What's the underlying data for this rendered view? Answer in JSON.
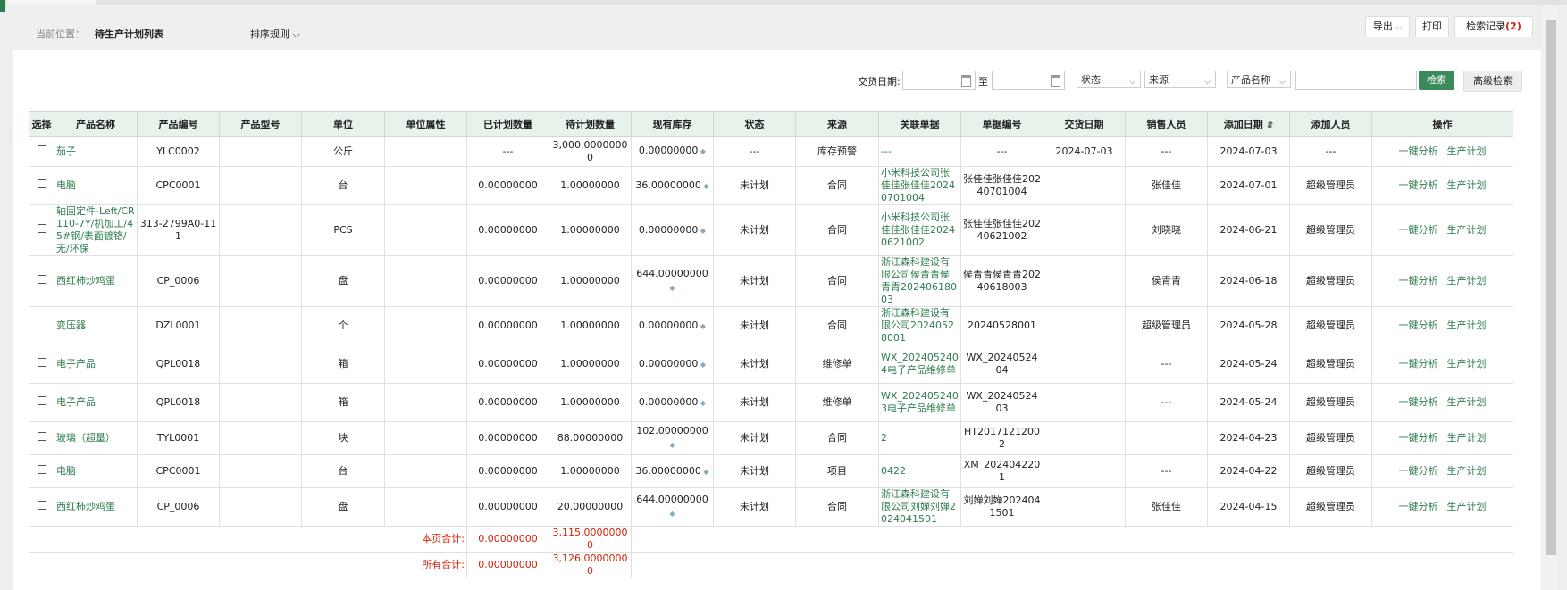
{
  "breadcrumb": {
    "label": "当前位置：",
    "value": "待生产计划列表"
  },
  "sort_label": "排序规则",
  "toolbar": {
    "export": "导出",
    "print": "打印",
    "search_record": "检索记录",
    "search_record_count": "(2)"
  },
  "filters": {
    "delivery_date_label": "交货日期:",
    "to_label": "至",
    "status": "状态",
    "source": "来源",
    "product_name": "产品名称",
    "search": "检索",
    "advanced_search": "高级检索"
  },
  "columns": [
    "选择",
    "产品名称",
    "产品编号",
    "产品型号",
    "单位",
    "单位属性",
    "已计划数量",
    "待计划数量",
    "现有库存",
    "状态",
    "来源",
    "关联单据",
    "单据编号",
    "交货日期",
    "销售人员",
    "添加日期",
    "添加人员",
    "操作"
  ],
  "actions": {
    "analyze": "一键分析",
    "plan": "生产计划"
  },
  "rows": [
    {
      "name": "茄子",
      "code": "YLC0002",
      "model": "",
      "unit": "公斤",
      "unit_attr": "",
      "planned": "---",
      "pending": "3,000.0000000 0",
      "stock": "0.00000000",
      "status": "---",
      "source": "库存预警",
      "related": "---",
      "doc_no": "---",
      "delivery": "2024-07-03",
      "sales": "---",
      "added": "2024-07-03",
      "adder": "---"
    },
    {
      "name": "电脑",
      "code": "CPC0001",
      "model": "",
      "unit": "台",
      "unit_attr": "",
      "planned": "0.00000000",
      "pending": "1.00000000",
      "stock": "36.00000000",
      "status": "未计划",
      "source": "合同",
      "related": "小米科技公司张佳佳张佳佳20240701004",
      "doc_no": "张佳佳张佳佳20240701004",
      "delivery": "",
      "sales": "张佳佳",
      "added": "2024-07-01",
      "adder": "超级管理员"
    },
    {
      "name": "轴固定件-Left/CR110-7Y/机加工/45#钢/表面镀铬/无/环保",
      "code": "313-2799A0-111",
      "model": "",
      "unit": "PCS",
      "unit_attr": "",
      "planned": "0.00000000",
      "pending": "1.00000000",
      "stock": "0.00000000",
      "status": "未计划",
      "source": "合同",
      "related": "小米科技公司张佳佳张佳佳20240621002",
      "doc_no": "张佳佳张佳佳20240621002",
      "delivery": "",
      "sales": "刘晓晓",
      "added": "2024-06-21",
      "adder": "超级管理员"
    },
    {
      "name": "西红柿炒鸡蛋",
      "code": "CP_0006",
      "model": "",
      "unit": "盘",
      "unit_attr": "",
      "planned": "0.00000000",
      "pending": "1.00000000",
      "stock": "644.00000000",
      "status": "未计划",
      "source": "合同",
      "related": "浙江森科建设有限公司侯青青侯青青20240618003",
      "doc_no": "侯青青侯青青20240618003",
      "delivery": "",
      "sales": "侯青青",
      "added": "2024-06-18",
      "adder": "超级管理员"
    },
    {
      "name": "变压器",
      "code": "DZL0001",
      "model": "",
      "unit": "个",
      "unit_attr": "",
      "planned": "0.00000000",
      "pending": "1.00000000",
      "stock": "0.00000000",
      "status": "未计划",
      "source": "合同",
      "related": "浙江森科建设有限公司20240528001",
      "doc_no": "20240528001",
      "delivery": "",
      "sales": "超级管理员",
      "added": "2024-05-28",
      "adder": "超级管理员"
    },
    {
      "name": "电子产品",
      "code": "QPL0018",
      "model": "",
      "unit": "箱",
      "unit_attr": "",
      "planned": "0.00000000",
      "pending": "1.00000000",
      "stock": "0.00000000",
      "status": "未计划",
      "source": "维修单",
      "related": "WX_2024052404电子产品维修单",
      "doc_no": "WX_20240524 04",
      "delivery": "",
      "sales": "---",
      "added": "2024-05-24",
      "adder": "超级管理员"
    },
    {
      "name": "电子产品",
      "code": "QPL0018",
      "model": "",
      "unit": "箱",
      "unit_attr": "",
      "planned": "0.00000000",
      "pending": "1.00000000",
      "stock": "0.00000000",
      "status": "未计划",
      "source": "维修单",
      "related": "WX_2024052403电子产品维修单",
      "doc_no": "WX_20240524 03",
      "delivery": "",
      "sales": "---",
      "added": "2024-05-24",
      "adder": "超级管理员"
    },
    {
      "name": "玻璃（超量）",
      "code": "TYL0001",
      "model": "",
      "unit": "块",
      "unit_attr": "",
      "planned": "0.00000000",
      "pending": "88.00000000",
      "stock": "102.00000000",
      "status": "未计划",
      "source": "合同",
      "related": "2",
      "doc_no": "HT20171212002",
      "delivery": "",
      "sales": "",
      "added": "2024-04-23",
      "adder": "超级管理员"
    },
    {
      "name": "电脑",
      "code": "CPC0001",
      "model": "",
      "unit": "台",
      "unit_attr": "",
      "planned": "0.00000000",
      "pending": "1.00000000",
      "stock": "36.00000000",
      "status": "未计划",
      "source": "项目",
      "related": "0422",
      "doc_no": "XM_2024042201",
      "delivery": "",
      "sales": "---",
      "added": "2024-04-22",
      "adder": "超级管理员"
    },
    {
      "name": "西红柿炒鸡蛋",
      "code": "CP_0006",
      "model": "",
      "unit": "盘",
      "unit_attr": "",
      "planned": "0.00000000",
      "pending": "20.00000000",
      "stock": "644.00000000",
      "status": "未计划",
      "source": "合同",
      "related": "浙江森科建设有限公司刘婵刘婵2024041501",
      "doc_no": "刘婵刘婵2024041501",
      "delivery": "",
      "sales": "张佳佳",
      "added": "2024-04-15",
      "adder": "超级管理员"
    }
  ],
  "totals": {
    "page_label": "本页合计:",
    "page_planned": "0.00000000",
    "page_pending": "3,115.00000000",
    "all_label": "所有合计:",
    "all_planned": "0.00000000",
    "all_pending": "3,126.00000000"
  }
}
